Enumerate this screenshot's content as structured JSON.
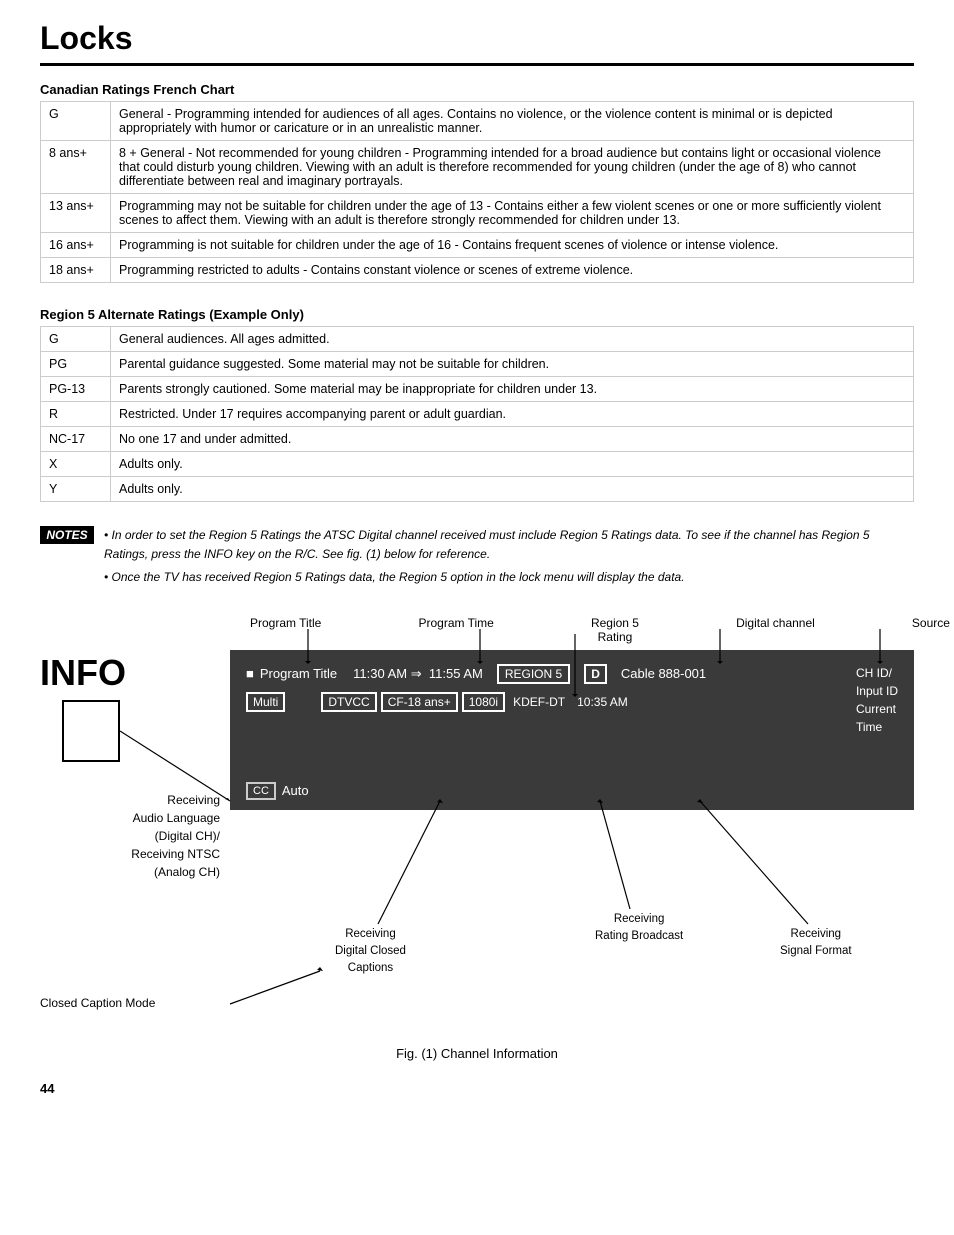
{
  "page": {
    "title": "Locks",
    "number": "44"
  },
  "canadian_table": {
    "section_title": "Canadian Ratings French Chart",
    "rows": [
      {
        "rating": "G",
        "description": "General - Programming intended for audiences of all ages. Contains no violence, or the violence content is minimal or is depicted appropriately with humor or caricature or in an unrealistic manner."
      },
      {
        "rating": "8 ans+",
        "description": "8 + General - Not recommended for young children - Programming intended for a broad audience but contains light or occasional violence that could disturb young children. Viewing with an adult is therefore recommended for young children (under the age of 8) who cannot differentiate between real and imaginary portrayals."
      },
      {
        "rating": "13 ans+",
        "description": "Programming may not be suitable for children under the age of 13 - Contains either a few violent scenes or one or more sufficiently violent scenes to affect them. Viewing with an adult is therefore strongly recommended for children under 13."
      },
      {
        "rating": "16 ans+",
        "description": "Programming is not suitable for children under the age of 16 - Contains frequent scenes of violence or intense violence."
      },
      {
        "rating": "18 ans+",
        "description": "Programming restricted to adults - Contains constant violence or scenes of extreme violence."
      }
    ]
  },
  "region5_table": {
    "section_title": "Region 5 Alternate Ratings (Example Only)",
    "rows": [
      {
        "rating": "G",
        "description": "General audiences. All ages admitted."
      },
      {
        "rating": "PG",
        "description": "Parental guidance suggested. Some material may not be suitable for children."
      },
      {
        "rating": "PG-13",
        "description": "Parents strongly cautioned. Some material may be inappropriate for children under 13."
      },
      {
        "rating": "R",
        "description": "Restricted. Under 17 requires accompanying parent or adult guardian."
      },
      {
        "rating": "NC-17",
        "description": "No one 17 and under admitted."
      },
      {
        "rating": "X",
        "description": "Adults only."
      },
      {
        "rating": "Y",
        "description": "Adults only."
      }
    ]
  },
  "notes": {
    "label": "NOTES",
    "bullets": [
      "In order to set the Region 5 Ratings the ATSC Digital channel received must include Region 5 Ratings data. To see if the channel has Region 5 Ratings, press the INFO key on the R/C. See fig. (1) below for reference.",
      "Once the TV has received Region 5 Ratings data, the Region 5 option in the lock menu will display the data."
    ]
  },
  "diagram": {
    "info_label": "INFO",
    "top_labels": [
      "Program Title",
      "Program Time",
      "Region 5\nRating",
      "Digital channel",
      "Source"
    ],
    "tv_row1": {
      "program_title_marker": "■",
      "program_title": "Program Title",
      "time": "11:30 AM ⇒  11:55 AM",
      "region5_box": "REGION 5",
      "d_box": "D",
      "cable": "Cable 888-001",
      "kdef": "KDEF-DT",
      "ch_id_label": "CH ID/\nInput ID\nCurrent\nTime"
    },
    "tv_row2": {
      "multi_box": "Multi",
      "dtvcc_box": "DTVCC",
      "cf_box": "CF-18 ans+",
      "resolution_box": "1080i",
      "time2": "10:35 AM"
    },
    "tv_bottom": {
      "cc_box": "CC",
      "auto_label": "Auto"
    },
    "left_side_labels": [
      "Receiving\nAudio Language\n(Digital CH)/\nReceiving NTSC\n(Analog CH)"
    ],
    "arrow_labels": [
      "Receiving\nDigital Closed\nCaptions",
      "Receiving\nRating Broadcast",
      "Receiving\nSignal Format"
    ],
    "closed_caption_mode": "Closed Caption Mode",
    "fig_caption": "Fig. (1) Channel Information"
  }
}
